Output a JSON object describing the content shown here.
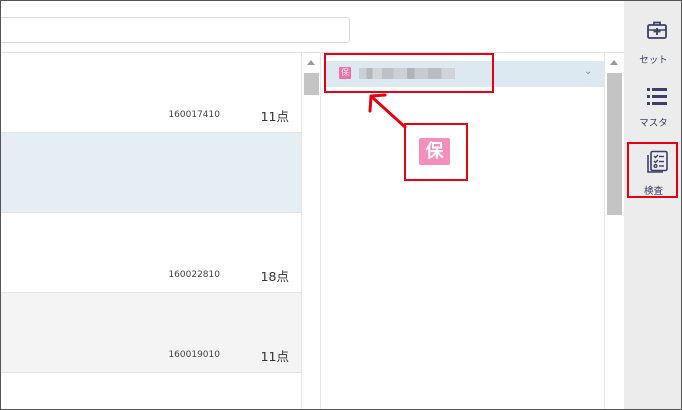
{
  "search": {
    "placeholder": ""
  },
  "list": {
    "rows": [
      {
        "code": "160017410",
        "points": "11点",
        "bg": "#ffffff"
      },
      {
        "code": "",
        "points": "",
        "bg": "#e4eef3"
      },
      {
        "code": "160022810",
        "points": "18点",
        "bg": "#ffffff"
      },
      {
        "code": "160019010",
        "points": "11点",
        "bg": "#f4f4f4"
      }
    ]
  },
  "panel": {
    "header_badge": "保",
    "big_badge": "保"
  },
  "toolbar": {
    "items": [
      {
        "label": "セット",
        "icon": "briefcase-plus-icon"
      },
      {
        "label": "マスタ",
        "icon": "list-icon"
      },
      {
        "label": "検査",
        "icon": "checklist-icon"
      }
    ]
  },
  "colors": {
    "accent": "#3a3f6b",
    "highlight": "#e60012",
    "badge": "#f26fa8",
    "selected_row": "#e4eef3"
  }
}
